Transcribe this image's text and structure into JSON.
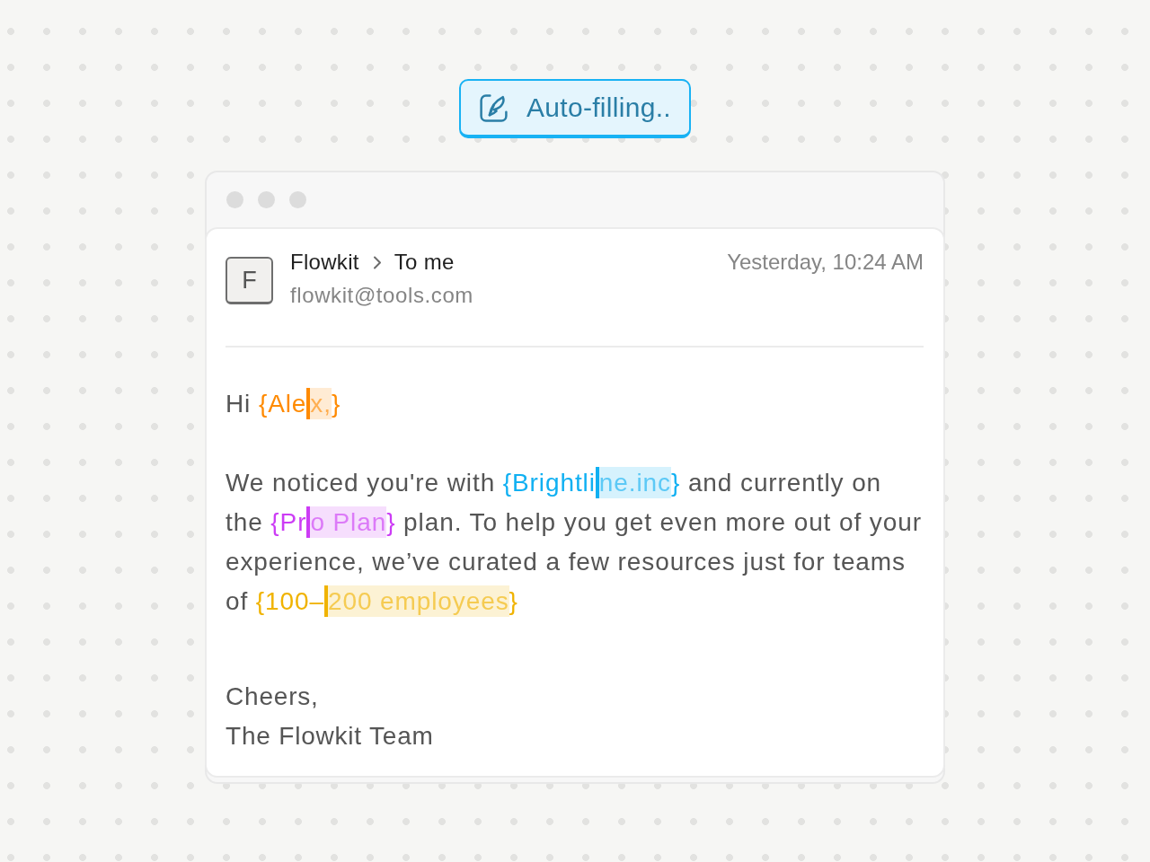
{
  "status": {
    "label": "Auto-filling.."
  },
  "email": {
    "sender": {
      "initial": "F",
      "name": "Flowkit",
      "recipient": "To me",
      "address": "flowkit@tools.com"
    },
    "time": "Yesterday, 10:24 AM",
    "paragraphs": [
      [
        {
          "kind": "text",
          "text": "Hi "
        },
        {
          "kind": "field",
          "typed": "{Ale",
          "pending": "x,",
          "closing": "}",
          "color": "#ff8a00"
        }
      ],
      [
        {
          "kind": "text",
          "text": "We noticed you're with "
        },
        {
          "kind": "field",
          "typed": "{Brightli",
          "pending": "ne.inc",
          "closing": "}",
          "color": "#10b0f2"
        },
        {
          "kind": "text",
          "text": " and currently on the "
        },
        {
          "kind": "field",
          "typed": "{Pr",
          "pending": "o Plan",
          "closing": "}",
          "color": "#cc3cf5"
        },
        {
          "kind": "text",
          "text": " plan. To help you get even more out of your experience, we’ve curated a few resources just for teams of "
        },
        {
          "kind": "field",
          "typed": "{100–",
          "pending": "200 employees",
          "closing": "}",
          "color": "#f0b300"
        }
      ]
    ],
    "closing": [
      "Cheers,",
      "The Flowkit Team"
    ]
  }
}
